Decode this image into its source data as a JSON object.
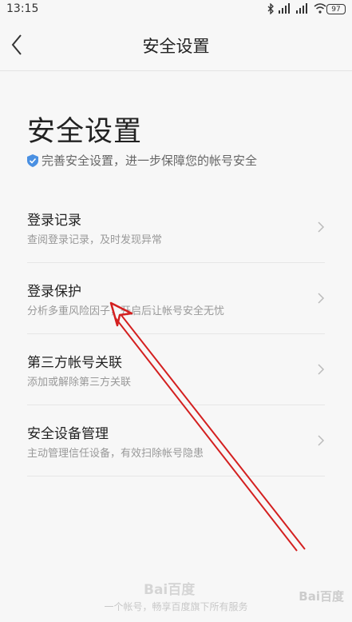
{
  "status_bar": {
    "time": "13:15",
    "battery": "97"
  },
  "header": {
    "title": "安全设置"
  },
  "main": {
    "title": "安全设置",
    "subtitle": "完善安全设置，进一步保障您的帐号安全",
    "items": [
      {
        "title": "登录记录",
        "desc": "查阅登录记录，及时发现异常"
      },
      {
        "title": "登录保护",
        "desc": "分析多重风险因子，开启后让帐号安全无忧"
      },
      {
        "title": "第三方帐号关联",
        "desc": "添加或解除第三方关联"
      },
      {
        "title": "安全设备管理",
        "desc": "主动管理信任设备，有效扫除帐号隐患"
      }
    ]
  },
  "footer": {
    "logo": "Bai百度",
    "text": "一个帐号，畅享百度旗下所有服务",
    "watermark": "Bai百度"
  },
  "colors": {
    "accent": "#4a90e2",
    "annotation": "#d42020"
  }
}
